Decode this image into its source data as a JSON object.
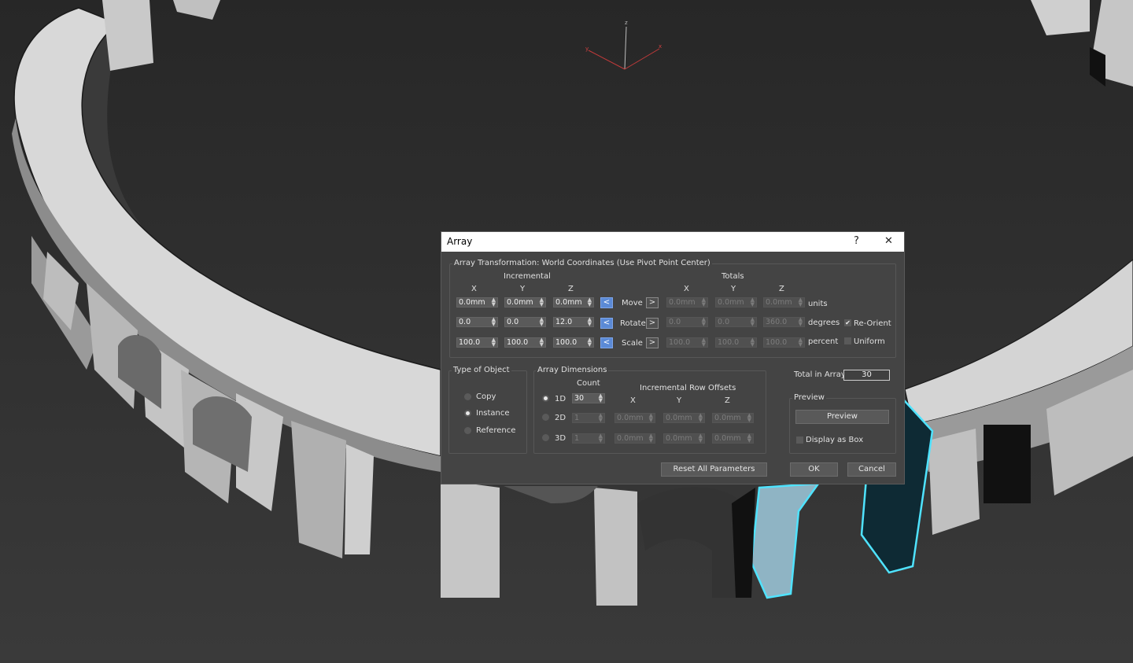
{
  "viewport": {
    "axis_labels": {
      "z": "z",
      "y": "y",
      "x": "x"
    }
  },
  "dialog": {
    "title": "Array",
    "help_label": "?",
    "close_label": "✕",
    "transformation": {
      "group_label": "Array Transformation: World Coordinates (Use Pivot Point Center)",
      "incremental_label": "Incremental",
      "totals_label": "Totals",
      "axis_x": "X",
      "axis_y": "Y",
      "axis_z": "Z",
      "left_arrow": "<",
      "right_arrow": ">",
      "rows": {
        "move": {
          "label": "Move",
          "inc": [
            "0.0mm",
            "0.0mm",
            "0.0mm"
          ],
          "tot": [
            "0.0mm",
            "0.0mm",
            "0.0mm"
          ],
          "unit": "units"
        },
        "rotate": {
          "label": "Rotate",
          "inc": [
            "0.0",
            "0.0",
            "12.0"
          ],
          "tot": [
            "0.0",
            "0.0",
            "360.0"
          ],
          "unit": "degrees"
        },
        "scale": {
          "label": "Scale",
          "inc": [
            "100.0",
            "100.0",
            "100.0"
          ],
          "tot": [
            "100.0",
            "100.0",
            "100.0"
          ],
          "unit": "percent"
        }
      },
      "reorient_label": "Re-Orient",
      "reorient_checked": true,
      "uniform_label": "Uniform",
      "uniform_checked": false
    },
    "type_of_object": {
      "group_label": "Type of Object",
      "options": [
        "Copy",
        "Instance",
        "Reference"
      ],
      "selected": "Instance"
    },
    "array_dimensions": {
      "group_label": "Array Dimensions",
      "count_label": "Count",
      "offsets_label": "Incremental Row Offsets",
      "axis_x": "X",
      "axis_y": "Y",
      "axis_z": "Z",
      "rows": [
        {
          "label": "1D",
          "count": "30",
          "x": "",
          "y": "",
          "z": ""
        },
        {
          "label": "2D",
          "count": "1",
          "x": "0.0mm",
          "y": "0.0mm",
          "z": "0.0mm"
        },
        {
          "label": "3D",
          "count": "1",
          "x": "0.0mm",
          "y": "0.0mm",
          "z": "0.0mm"
        }
      ],
      "selected": "1D"
    },
    "total_in_array_label": "Total in Array:",
    "total_in_array": "30",
    "preview": {
      "group_label": "Preview",
      "button_label": "Preview",
      "display_as_box_label": "Display as Box",
      "display_as_box_checked": false
    },
    "reset_label": "Reset All Parameters",
    "ok_label": "OK",
    "cancel_label": "Cancel"
  },
  "colors": {
    "accent": "#5b8ad6",
    "selection": "#4fe3ff",
    "background": "#2b2b2b"
  }
}
